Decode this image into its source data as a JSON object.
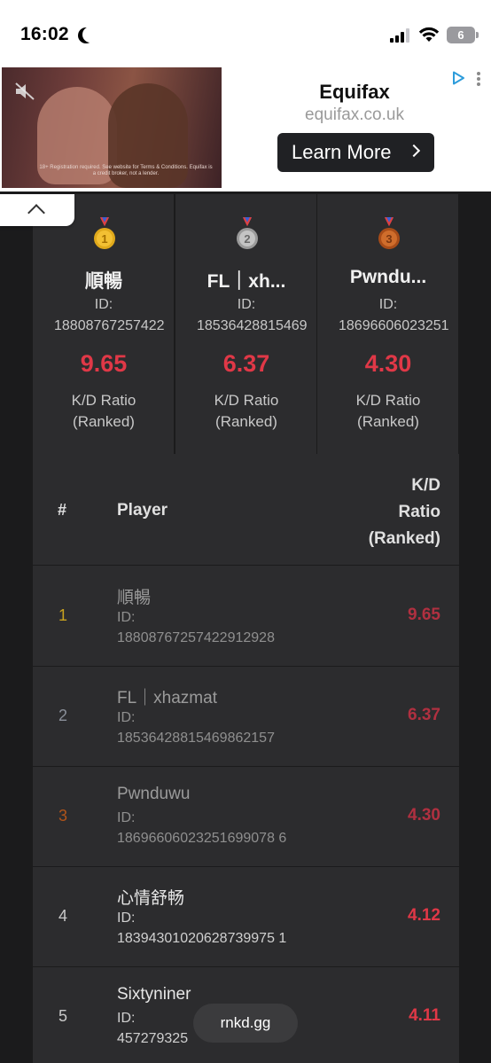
{
  "status_bar": {
    "time": "16:02",
    "battery": "6"
  },
  "ad": {
    "brand": "Equifax",
    "domain": "equifax.co.uk",
    "cta_label": "Learn More",
    "fine_print": "18+ Registration required. See website for Terms & Conditions. Equifax is a credit broker, not a lender."
  },
  "podium": [
    {
      "place": "1",
      "name": "順暢",
      "id_label": "ID:",
      "id_value": "18808767257422",
      "kd": "9.65",
      "kd_label_line1": "K/D Ratio",
      "kd_label_line2": "(Ranked)",
      "medal_color": "#e0a91b"
    },
    {
      "place": "2",
      "name": "FL｜xh...",
      "id_label": "ID:",
      "id_value": "18536428815469",
      "kd": "6.37",
      "kd_label_line1": "K/D Ratio",
      "kd_label_line2": "(Ranked)",
      "medal_color": "#a7a7a7"
    },
    {
      "place": "3",
      "name": "Pwndu...",
      "id_label": "ID:",
      "id_value": "18696606023251",
      "kd": "4.30",
      "kd_label_line1": "K/D Ratio",
      "kd_label_line2": "(Ranked)",
      "medal_color": "#b0541a"
    }
  ],
  "table": {
    "headers": {
      "rank": "#",
      "player": "Player",
      "kd_line1": "K/D",
      "kd_line2": "Ratio",
      "kd_line3": "(Ranked)"
    },
    "rows": [
      {
        "rank": "1",
        "name": "順暢",
        "id_label": "ID:",
        "id_value": "18808767257422912928",
        "kd": "9.65"
      },
      {
        "rank": "2",
        "name": "FL｜xhazmat",
        "id_label": "ID:",
        "id_value": "18536428815469862157",
        "kd": "6.37"
      },
      {
        "rank": "3",
        "name": "Pwnduwu",
        "id_label": "ID:",
        "id_value": "18696606023251699078 6",
        "kd": "4.30"
      },
      {
        "rank": "4",
        "name": "心情舒畅",
        "id_label": "ID:",
        "id_value": "18394301020628739975 1",
        "kd": "4.12"
      },
      {
        "rank": "5",
        "name": "Sixtyniner",
        "id_label": "ID:",
        "id_value": "457279325",
        "kd": "4.11"
      }
    ]
  },
  "colors": {
    "gold": "#c8a21f",
    "silver": "#8a8f99",
    "bronze": "#b0541a",
    "kd_red": "#e03847",
    "kd_red_dim": "#b03040"
  },
  "domain_pill": "rnkd.gg"
}
